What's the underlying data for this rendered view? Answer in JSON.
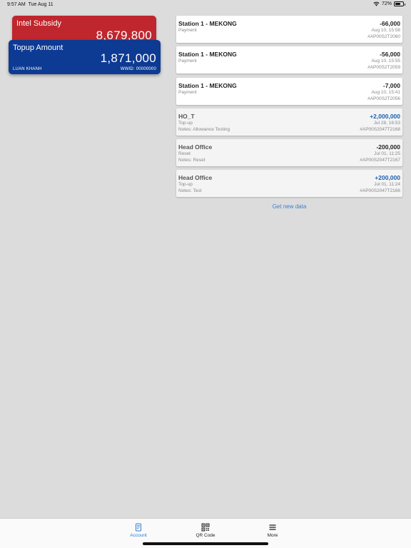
{
  "status_bar": {
    "time": "9:57 AM",
    "date": "Tue Aug 11",
    "battery": "72%",
    "battery_level": 0.72
  },
  "cards": {
    "subsidy": {
      "label": "Intel Subsidy",
      "amount": "8,679,800",
      "color": "#c0262d"
    },
    "topup": {
      "label": "Topup Amount",
      "amount": "1,871,000",
      "holder": "LUAN KHANH",
      "wwid": "WWID: 00000000",
      "color": "#0d3a92"
    }
  },
  "transactions": [
    {
      "merchant": "Station 1 - MEKONG",
      "type": "Payment",
      "notes": "",
      "amount": "-66,000",
      "date": "Aug 10, 15:58",
      "id": "#AP00S2T2060"
    },
    {
      "merchant": "Station 1 - MEKONG",
      "type": "Payment",
      "notes": "",
      "amount": "-56,000",
      "date": "Aug 10, 15:55",
      "id": "#AP00S2T2059"
    },
    {
      "merchant": "Station 1 - MEKONG",
      "type": "Payment",
      "notes": "",
      "amount": "-7,000",
      "date": "Aug 10, 15:41",
      "id": "#AP00S2T2056"
    },
    {
      "merchant": "HO_T",
      "type": "Top-up",
      "notes": "Notes: Allowance Testing",
      "amount": "+2,000,000",
      "date": "Jul 28, 16:53",
      "id": "#AP00S2047T2168"
    },
    {
      "merchant": "Head Office",
      "type": "Reset",
      "notes": "Notes: Reset",
      "amount": "-200,000",
      "date": "Jul 01, 11:25",
      "id": "#AP00S2047T2167"
    },
    {
      "merchant": "Head Office",
      "type": "Top-up",
      "notes": "Notes: Test",
      "amount": "+200,000",
      "date": "Jul 01, 11:24",
      "id": "#AP00S2047T2166"
    }
  ],
  "get_new_data": "Get new data",
  "tabs": [
    {
      "label": "Account",
      "icon": "account-icon",
      "active": true
    },
    {
      "label": "QR Code",
      "icon": "qr-code-icon",
      "active": false
    },
    {
      "label": "More",
      "icon": "menu-icon",
      "active": false
    }
  ],
  "colors": {
    "accent": "#2f7bd1",
    "positive": "#1b5fb0"
  }
}
